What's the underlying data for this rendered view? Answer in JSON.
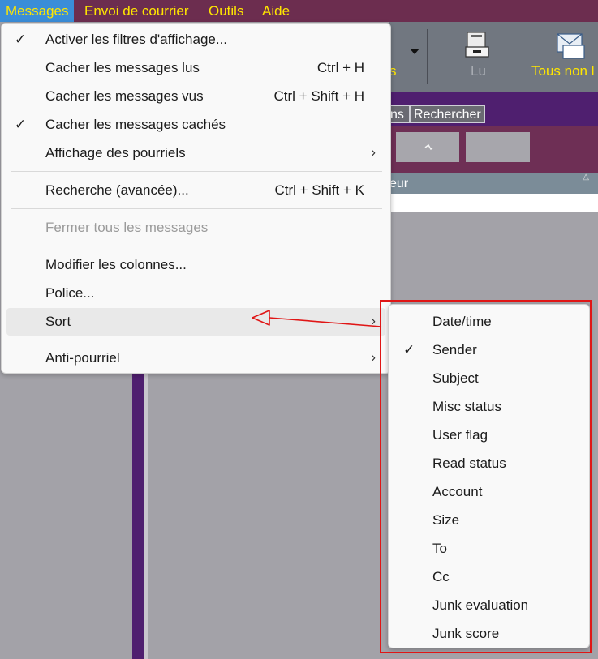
{
  "menubar": {
    "items": [
      {
        "label": "Messages",
        "active": true
      },
      {
        "label": "Envoi de courrier"
      },
      {
        "label": "Outils"
      },
      {
        "label": "Aide"
      }
    ]
  },
  "toolbar": {
    "partial_left_label": "s",
    "read_label": "Lu",
    "all_unread_label": "Tous non l"
  },
  "tabs": {
    "partial_tab": "ns",
    "search_tab": "Rechercher"
  },
  "columns": {
    "partial_header": "eur"
  },
  "main_menu": {
    "items": [
      {
        "label": "Activer les filtres d'affichage...",
        "checked": true
      },
      {
        "label": "Cacher les messages lus",
        "shortcut": "Ctrl + H"
      },
      {
        "label": "Cacher les messages vus",
        "shortcut": "Ctrl + Shift + H"
      },
      {
        "label": "Cacher les messages cachés",
        "checked": true
      },
      {
        "label": "Affichage des pourriels",
        "submenu": true
      },
      {
        "label": "Recherche (avancée)...",
        "shortcut": "Ctrl + Shift + K"
      },
      {
        "label": "Fermer tous les messages",
        "disabled": true
      },
      {
        "label": "Modifier les colonnes..."
      },
      {
        "label": "Police..."
      },
      {
        "label": "Sort",
        "submenu": true,
        "highlighted": true
      },
      {
        "label": "Anti-pourriel",
        "submenu": true
      }
    ]
  },
  "sort_submenu": {
    "items": [
      {
        "label": "Date/time"
      },
      {
        "label": "Sender",
        "checked": true
      },
      {
        "label": "Subject"
      },
      {
        "label": "Misc status"
      },
      {
        "label": "User flag"
      },
      {
        "label": "Read status"
      },
      {
        "label": "Account"
      },
      {
        "label": "Size"
      },
      {
        "label": "To"
      },
      {
        "label": "Cc"
      },
      {
        "label": "Junk evaluation"
      },
      {
        "label": "Junk score"
      }
    ]
  },
  "icons": {
    "check": "✓",
    "chevron": "›",
    "dropdown_arrow": "chevron-down-icon",
    "annotation_color": "#e01616"
  }
}
